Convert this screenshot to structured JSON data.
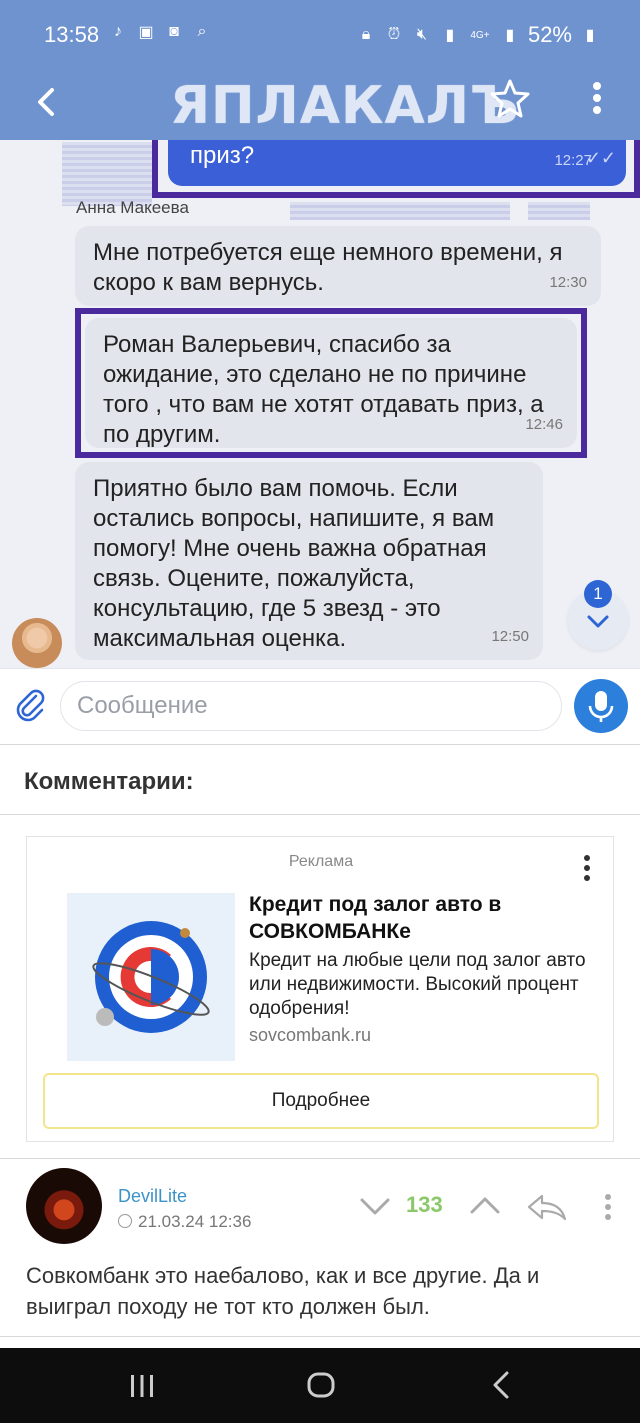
{
  "status_bar": {
    "time": "13:58",
    "battery": "52%",
    "network": "4G+"
  },
  "header": {
    "logo_text": "ЯПЛАКАЛЪ"
  },
  "chat": {
    "quoted_message": {
      "text": "приз?",
      "time": "12:27"
    },
    "sender": "Анна Макеева",
    "messages": [
      {
        "text": "Мне потребуется еще немного времени, я скоро к вам вернусь.",
        "time": "12:30"
      },
      {
        "text": "Роман Валерьевич, спасибо за ожидание, это сделано не по причине того , что вам не хотят отдавать приз, а по другим.",
        "time": "12:46"
      },
      {
        "text": "Приятно было вам помочь. Если остались вопросы, напишите, я вам помогу! Мне очень важна обратная связь. Оцените, пожалуйста, консультацию, где 5 звезд - это максимальная оценка.",
        "time": "12:50"
      }
    ],
    "unread_badge": "1",
    "composer_placeholder": "Сообщение"
  },
  "comments": {
    "title": "Комментарии:"
  },
  "ad": {
    "label": "Реклама",
    "title": "Кредит под залог авто в СОВКОМБАНКе",
    "description": "Кредит на любые цели под залог авто или недвижимости. Высокий процент одобрения!",
    "domain": "sovcombank.ru",
    "button": "Подробнее"
  },
  "comment": {
    "author": "DevilLite",
    "date": "21.03.24 12:36",
    "score": "133",
    "text": "Совкомбанк это наебалово, как и все другие. Да и выиграл походу не тот кто должен был."
  },
  "colors": {
    "header_bg": "#6f93cf",
    "highlight_box": "#4b2a9e",
    "author_link": "#3c92c8",
    "score_positive": "#8bc86a",
    "mic_button": "#2d7fdc"
  }
}
